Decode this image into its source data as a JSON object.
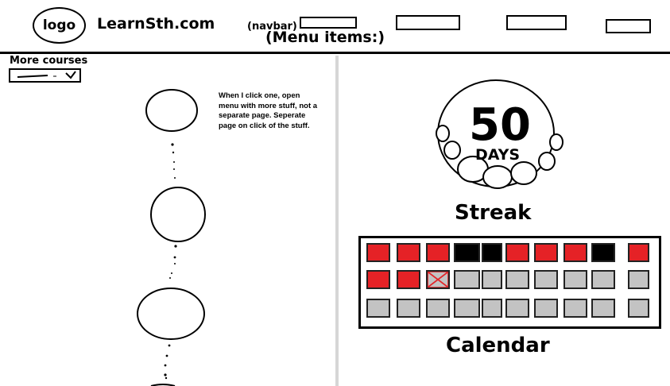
{
  "navbar": {
    "logo_text": "logo",
    "site_name": "LearnSth.com",
    "note": "(navbar)",
    "menu_label": "(Menu items:)",
    "menu_items": [
      "",
      "",
      "",
      ""
    ]
  },
  "courses": {
    "more_label": "More courses",
    "dropdown_value": "",
    "note": "When I click one, open menu with more stuff, not a separate page. Seperate page on click of the stuff."
  },
  "streak": {
    "count": "50",
    "unit": "DAYS",
    "title": "Streak"
  },
  "calendar": {
    "title": "Calendar",
    "legend_colors": {
      "done": "#e52226",
      "missed": "#000000",
      "future": "#c3c3c3",
      "today_mark": "#e52226"
    },
    "rows": [
      [
        "done",
        "done",
        "done",
        "missed",
        "missed",
        "done",
        "done",
        "done",
        "missed",
        "done"
      ],
      [
        "done",
        "done",
        "today",
        "future",
        "future",
        "future",
        "future",
        "future",
        "future",
        "future"
      ],
      [
        "future",
        "future",
        "future",
        "future",
        "future",
        "future",
        "future",
        "future",
        "future",
        "future"
      ]
    ]
  }
}
